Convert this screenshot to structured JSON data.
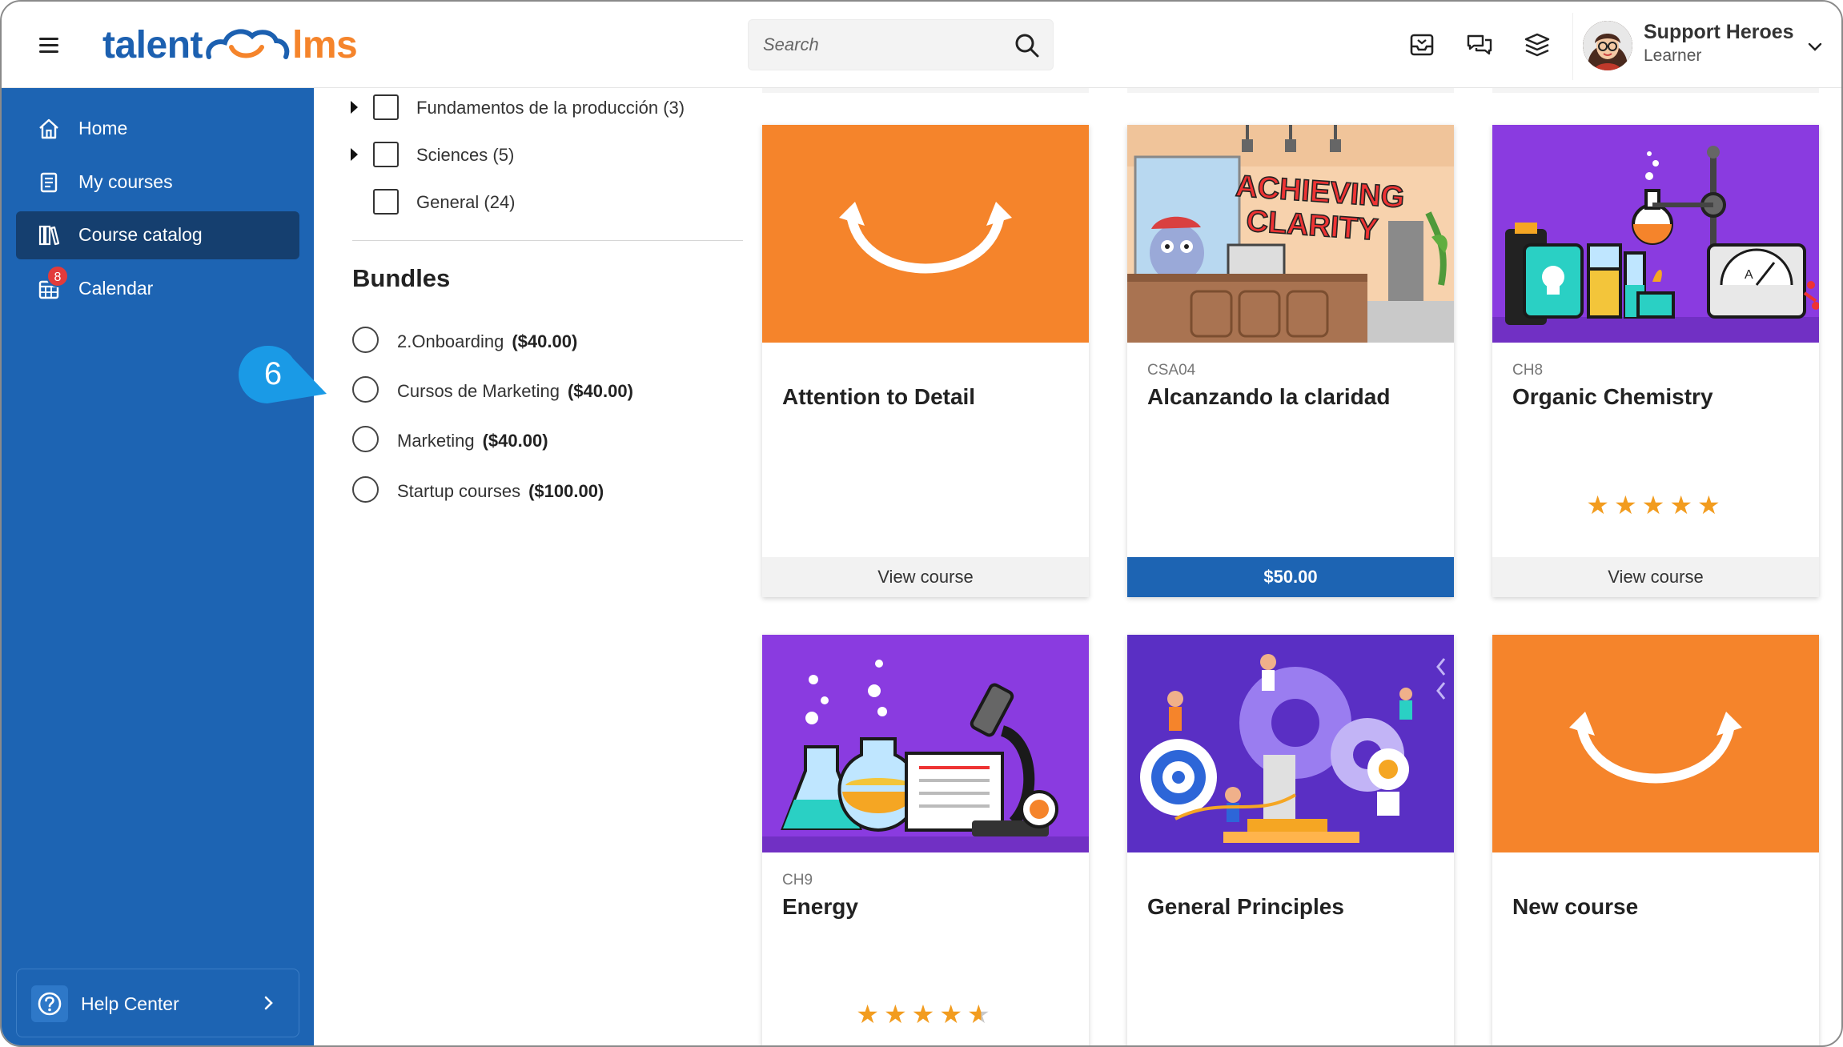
{
  "header": {
    "logo_left": "talent",
    "logo_right": "lms",
    "search_placeholder": "Search",
    "icons": [
      "inbox-icon",
      "messages-icon",
      "layers-icon"
    ],
    "user": {
      "name": "Support Heroes",
      "role": "Learner"
    }
  },
  "sidebar": {
    "items": [
      {
        "label": "Home",
        "icon": "home-icon",
        "active": false
      },
      {
        "label": "My courses",
        "icon": "book-icon",
        "active": false
      },
      {
        "label": "Course catalog",
        "icon": "library-icon",
        "active": true
      },
      {
        "label": "Calendar",
        "icon": "calendar-icon",
        "active": false,
        "badge": "8"
      }
    ],
    "help": {
      "label": "Help Center"
    }
  },
  "filters": {
    "categories": [
      {
        "label": "Fundamentos de la producción (3)",
        "expandable": true
      },
      {
        "label": "Sciences (5)",
        "expandable": true
      },
      {
        "label": "General (24)",
        "expandable": false
      }
    ],
    "bundles_title": "Bundles",
    "bundles": [
      {
        "name": "2.Onboarding",
        "price": "($40.00)"
      },
      {
        "name": "Cursos de Marketing",
        "price": "($40.00)"
      },
      {
        "name": "Marketing",
        "price": "($40.00)"
      },
      {
        "name": "Startup courses",
        "price": "($100.00)"
      }
    ]
  },
  "callout": {
    "number": "6"
  },
  "courses": [
    {
      "code": "",
      "title": "Attention to Detail",
      "footer": "View course",
      "paid": false,
      "rating": null
    },
    {
      "code": "CSA04",
      "title": "Alcanzando la claridad",
      "footer": "$50.00",
      "paid": true,
      "rating": null,
      "image_text_1": "ACHIEVING",
      "image_text_2": "CLARITY"
    },
    {
      "code": "CH8",
      "title": "Organic Chemistry",
      "footer": "View course",
      "paid": false,
      "rating": 5
    },
    {
      "code": "CH9",
      "title": "Energy",
      "footer": "",
      "paid": false,
      "rating": 4.5
    },
    {
      "code": "",
      "title": "General Principles",
      "footer": "",
      "paid": false,
      "rating": null
    },
    {
      "code": "",
      "title": "New course",
      "footer": "",
      "paid": false,
      "rating": null
    }
  ],
  "colors": {
    "brand_blue": "#1d64b3",
    "sidebar_active": "#153f6f",
    "brand_orange": "#f5842b",
    "purple_thumb": "#8a3be0",
    "star": "#f29c1f",
    "badge_red": "#e23b3b"
  }
}
